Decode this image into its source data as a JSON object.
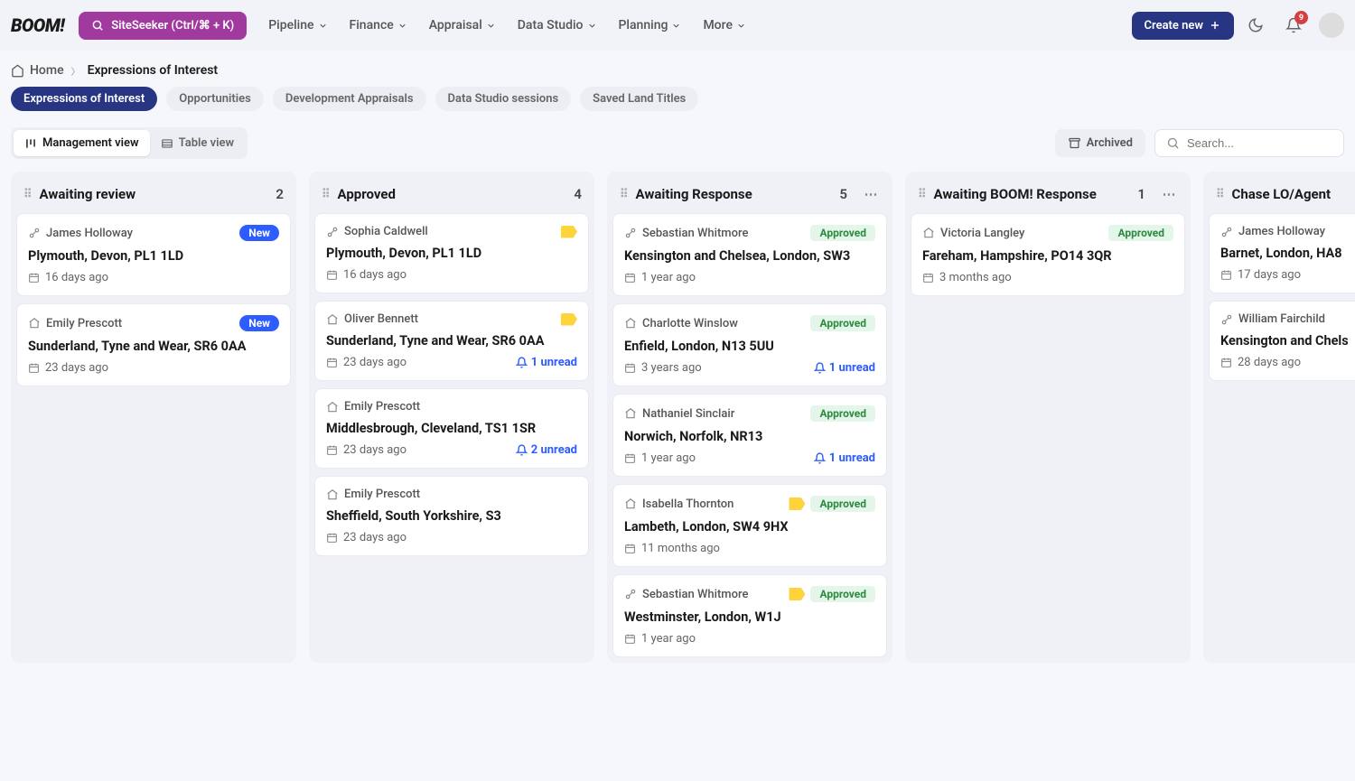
{
  "header": {
    "logo": "BOOM!",
    "siteSeeker": "SiteSeeker (Ctrl/⌘ + K)",
    "nav": [
      "Pipeline",
      "Finance",
      "Appraisal",
      "Data Studio",
      "Planning",
      "More"
    ],
    "createNew": "Create new",
    "notifCount": "9"
  },
  "breadcrumbs": {
    "home": "Home",
    "current": "Expressions of Interest"
  },
  "tabs": [
    "Expressions of Interest",
    "Opportunities",
    "Development Appraisals",
    "Data Studio sessions",
    "Saved Land Titles"
  ],
  "views": {
    "management": "Management view",
    "table": "Table view"
  },
  "archived": "Archived",
  "searchPlaceholder": "Search...",
  "columns": [
    {
      "title": "Awaiting review",
      "count": "2",
      "menu": false,
      "cards": [
        {
          "icon": "link",
          "person": "James Holloway",
          "badge": "New",
          "yellow": false,
          "title": "Plymouth, Devon, PL1 1LD",
          "time": "16 days ago",
          "unread": ""
        },
        {
          "icon": "home",
          "person": "Emily Prescott",
          "badge": "New",
          "yellow": false,
          "title": "Sunderland, Tyne and Wear, SR6 0AA",
          "time": "23 days ago",
          "unread": ""
        }
      ]
    },
    {
      "title": "Approved",
      "count": "4",
      "menu": false,
      "cards": [
        {
          "icon": "link",
          "person": "Sophia Caldwell",
          "badge": "",
          "yellow": true,
          "title": "Plymouth, Devon, PL1 1LD",
          "time": "16 days ago",
          "unread": ""
        },
        {
          "icon": "home",
          "person": "Oliver Bennett",
          "badge": "",
          "yellow": true,
          "title": "Sunderland, Tyne and Wear, SR6 0AA",
          "time": "23 days ago",
          "unread": "1 unread"
        },
        {
          "icon": "home",
          "person": "Emily Prescott",
          "badge": "",
          "yellow": false,
          "title": "Middlesbrough, Cleveland, TS1 1SR",
          "time": "23 days ago",
          "unread": "2 unread"
        },
        {
          "icon": "home",
          "person": "Emily Prescott",
          "badge": "",
          "yellow": false,
          "title": "Sheffield, South Yorkshire, S3",
          "time": "23 days ago",
          "unread": ""
        }
      ]
    },
    {
      "title": "Awaiting Response",
      "count": "5",
      "menu": true,
      "cards": [
        {
          "icon": "link",
          "person": "Sebastian Whitmore",
          "badge": "Approved",
          "yellow": false,
          "title": "Kensington and Chelsea, London, SW3",
          "time": "1 year ago",
          "unread": ""
        },
        {
          "icon": "home",
          "person": "Charlotte Winslow",
          "badge": "Approved",
          "yellow": false,
          "title": "Enfield, London, N13 5UU",
          "time": "3 years ago",
          "unread": "1 unread"
        },
        {
          "icon": "home",
          "person": "Nathaniel Sinclair",
          "badge": "Approved",
          "yellow": false,
          "title": "Norwich, Norfolk, NR13",
          "time": "1 year ago",
          "unread": "1 unread"
        },
        {
          "icon": "home",
          "person": "Isabella Thornton",
          "badge": "Approved",
          "yellow": true,
          "title": "Lambeth, London, SW4 9HX",
          "time": "11 months ago",
          "unread": ""
        },
        {
          "icon": "link",
          "person": "Sebastian Whitmore",
          "badge": "Approved",
          "yellow": true,
          "title": "Westminster, London, W1J",
          "time": "1 year ago",
          "unread": ""
        }
      ]
    },
    {
      "title": "Awaiting BOOM! Response",
      "count": "1",
      "menu": true,
      "cards": [
        {
          "icon": "home",
          "person": "Victoria Langley",
          "badge": "Approved",
          "yellow": false,
          "title": "Fareham, Hampshire, PO14 3QR",
          "time": "3 months ago",
          "unread": ""
        }
      ]
    },
    {
      "title": "Chase LO/Agent",
      "count": "",
      "menu": false,
      "cards": [
        {
          "icon": "link",
          "person": "James Holloway",
          "badge": "",
          "yellow": false,
          "title": "Barnet, London, HA8",
          "time": "17 days ago",
          "unread": ""
        },
        {
          "icon": "link",
          "person": "William Fairchild",
          "badge": "",
          "yellow": false,
          "title": "Kensington and Chels",
          "time": "28 days ago",
          "unread": ""
        }
      ]
    }
  ]
}
